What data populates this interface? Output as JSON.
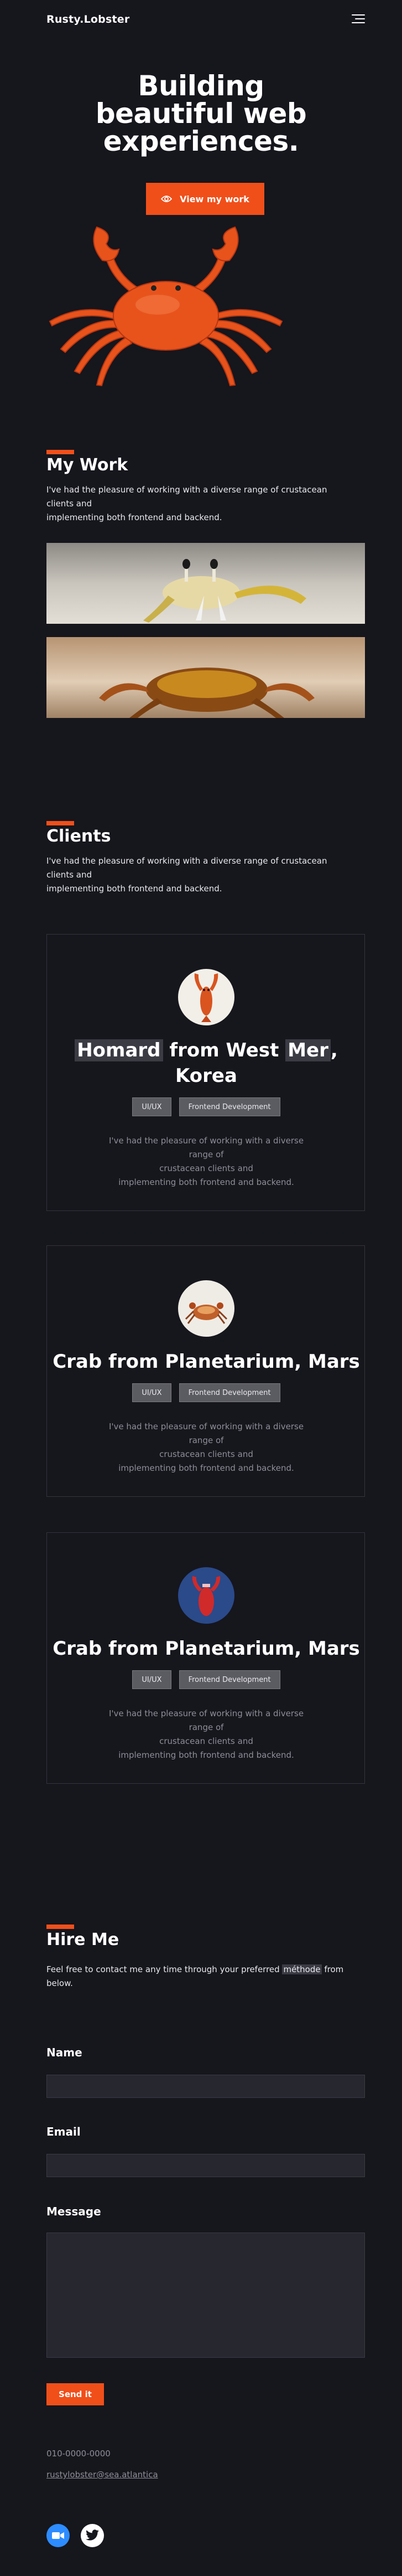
{
  "header": {
    "brand": "Rusty.Lobster",
    "menu_icon": "menu-icon"
  },
  "hero": {
    "title_lines": [
      "Building",
      "beautiful web",
      "experiences."
    ],
    "cta_label": "View my work",
    "cta_icon": "eye-icon"
  },
  "work": {
    "title": "My Work",
    "desc_lines": [
      "I've had the pleasure of working with a diverse range of crustacean",
      "clients and",
      "implementing both frontend and backend."
    ]
  },
  "clients": {
    "title": "Clients",
    "desc_lines": [
      "I've had the pleasure of working with a diverse range of crustacean",
      "clients and",
      "implementing both frontend and backend."
    ],
    "cards": [
      {
        "name_part1": "Homard",
        "name_part2": " from West ",
        "name_part3": "Mer",
        "name_part4": ",",
        "name_line2": "Korea",
        "tags": [
          "UI/UX",
          "Frontend Development"
        ],
        "desc_lines": [
          "I've had the pleasure of working with a diverse range of",
          "crustacean clients and",
          "implementing both frontend and backend."
        ]
      },
      {
        "name": "Crab from Planetarium, Mars",
        "tags": [
          "UI/UX",
          "Frontend Development"
        ],
        "desc_lines": [
          "I've had the pleasure of working with a diverse range of",
          "crustacean clients and",
          "implementing both frontend and backend."
        ]
      },
      {
        "name": "Crab from Planetarium, Mars",
        "tags": [
          "UI/UX",
          "Frontend Development"
        ],
        "desc_lines": [
          "I've had the pleasure of working with a diverse range of",
          "crustacean clients and",
          "implementing both frontend and backend."
        ]
      }
    ]
  },
  "hire": {
    "title": "Hire Me",
    "desc_part1": "Feel free to contact me any time through your preferred ",
    "desc_highlight": "méthode",
    "desc_part2": " from",
    "desc_line2": "below.",
    "name_label": "Name",
    "email_label": "Email",
    "message_label": "Message",
    "name_value": "",
    "email_value": "",
    "message_value": "",
    "send_label": "Send it",
    "phone": "010-0000-0000",
    "email_contact": "rustylobster@sea.atlantica"
  },
  "social": [
    "video-call-icon",
    "twitter-icon"
  ],
  "colors": {
    "accent": "#f04f1a",
    "background": "#16161d",
    "card_border": "#34343f",
    "zoom_blue": "#2d8cff"
  }
}
